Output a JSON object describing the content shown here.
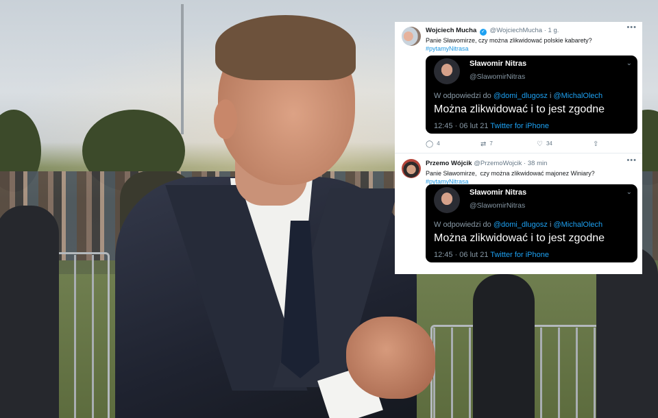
{
  "tweets": [
    {
      "author_name": "Wojciech Mucha",
      "verified": true,
      "handle": "@WojciechMucha",
      "time": "1 g.",
      "text": "Panie Sławomirze, czy można zlikwidować polskie kabarety?",
      "hashtag": "#pytamyNitrasa",
      "quoted": {
        "author_name": "Sławomir Nitras",
        "handle": "@SlawomirNitras",
        "reply_prefix": "W odpowiedzi do",
        "mention_1": "@domi_dlugosz",
        "reply_join": "i",
        "mention_2": "@MichalOlech",
        "text": "Można zlikwidować i to jest zgodne",
        "timestamp": "12:45 · 06 lut 21",
        "source": "Twitter for iPhone"
      },
      "actions": {
        "replies": "4",
        "retweets": "7",
        "likes": "34"
      }
    },
    {
      "author_name": "Przemo Wójcik",
      "verified": false,
      "handle": "@PrzemoWojcik",
      "time": "38 min",
      "text": "Panie Sławomirze,  czy można zlikwidować majonez Winiary?",
      "hashtag": "#pytamyNitrasa",
      "quoted": {
        "author_name": "Sławomir Nitras",
        "handle": "@SlawomirNitras",
        "reply_prefix": "W odpowiedzi do",
        "mention_1": "@domi_dlugosz",
        "reply_join": "i",
        "mention_2": "@MichalOlech",
        "text": "Można zlikwidować i to jest zgodne",
        "timestamp": "12:45 · 06 lut 21",
        "source": "Twitter for iPhone"
      }
    }
  ],
  "icons": {
    "more": "more-dots-icon",
    "verified": "verified-badge-icon",
    "chevron": "chevron-down-icon",
    "reply": "reply-icon",
    "retweet": "retweet-icon",
    "like": "heart-icon",
    "share": "share-icon"
  },
  "colors": {
    "link_blue": "#1da1f2",
    "hashtag_blue": "#1b95e0",
    "quote_background": "#000000",
    "panel_background": "#ffffff"
  }
}
